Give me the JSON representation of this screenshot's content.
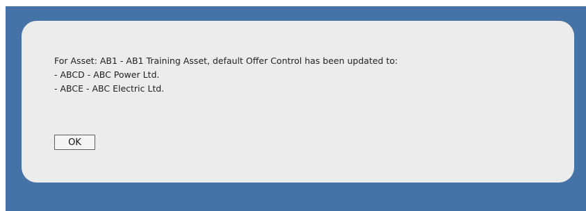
{
  "dialog": {
    "message_lines": [
      "For Asset: AB1 - AB1 Training Asset, default Offer Control has been updated to:",
      "- ABCD - ABC Power Ltd.",
      "- ABCE - ABC Electric Ltd."
    ],
    "ok_label": "OK"
  },
  "colors": {
    "backdrop": "#4573a7",
    "dialog_background": "#ececec"
  }
}
